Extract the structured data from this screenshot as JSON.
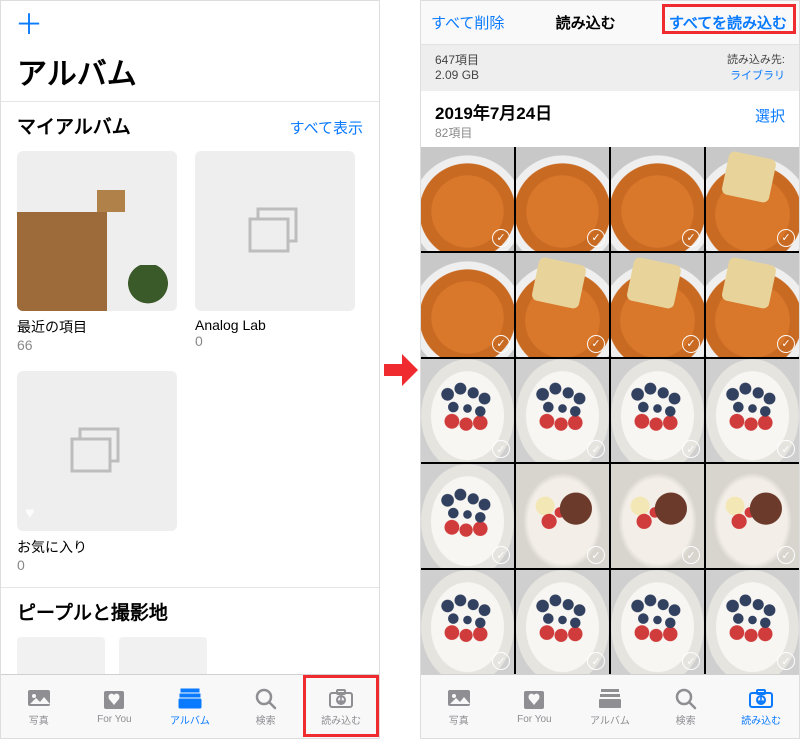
{
  "left": {
    "title": "アルバム",
    "my_albums": {
      "heading": "マイアルバム",
      "show_all": "すべて表示",
      "items": [
        {
          "name": "最近の項目",
          "count": "66"
        },
        {
          "name": "Analog Lab",
          "count": "0"
        },
        {
          "name": "お気に入り",
          "count": "0"
        }
      ]
    },
    "people_places": "ピープルと撮影地"
  },
  "right": {
    "top": {
      "delete_all": "すべて削除",
      "import": "読み込む",
      "import_all": "すべてを読み込む"
    },
    "meta": {
      "item_count": "647項目",
      "size": "2.09 GB",
      "dest_label": "読み込み先:",
      "dest_value": "ライブラリ"
    },
    "section": {
      "date": "2019年7月24日",
      "count": "82項目",
      "select": "選択"
    }
  },
  "tabs": {
    "photos": "写真",
    "for_you": "For You",
    "albums": "アルバム",
    "search": "検索",
    "import": "読み込む"
  },
  "grid_cells": [
    "soup",
    "soup",
    "soup",
    "soup-cr",
    "soup",
    "soup-cr",
    "soup-cr",
    "soup-cr",
    "fruit",
    "fruit",
    "fruit",
    "fruit",
    "fruit",
    "granola",
    "granola",
    "granola",
    "fruit",
    "fruit",
    "fruit",
    "fruit"
  ]
}
